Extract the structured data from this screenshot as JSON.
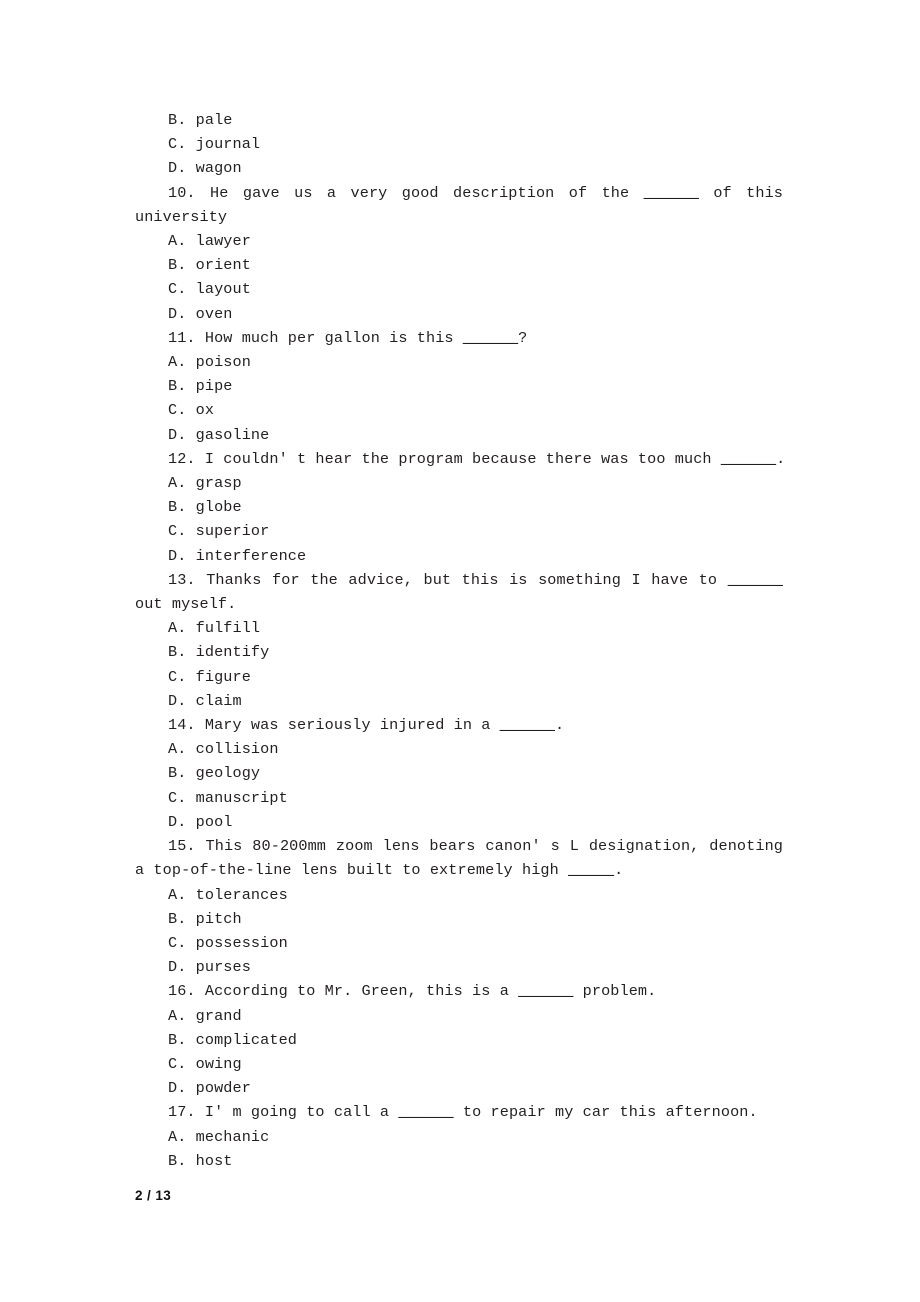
{
  "document": {
    "page_label": "2 / 13"
  },
  "blank_short": "______",
  "blank_tiny": "_____",
  "lines": [
    {
      "kind": "option",
      "text": "B.  pale"
    },
    {
      "kind": "option",
      "text": "C.  journal"
    },
    {
      "kind": "option",
      "text": "D.  wagon"
    },
    {
      "kind": "question_wrap",
      "pre": "10.  He gave us a very good description of the ",
      "blank": "______",
      "post": " of this university",
      "full": "10.  He gave us a very good description of the ______ of this university"
    },
    {
      "kind": "option",
      "text": "A.  lawyer"
    },
    {
      "kind": "option",
      "text": "B.  orient"
    },
    {
      "kind": "option",
      "text": "C.  layout"
    },
    {
      "kind": "option",
      "text": "D.  oven"
    },
    {
      "kind": "question",
      "pre": "11.  How much per gallon is this ",
      "blank": "______",
      "post": "?",
      "full": "11.  How much per gallon is this ______?"
    },
    {
      "kind": "option",
      "text": "A.  poison"
    },
    {
      "kind": "option",
      "text": "B.  pipe"
    },
    {
      "kind": "option",
      "text": "C.  ox"
    },
    {
      "kind": "option",
      "text": "D.  gasoline"
    },
    {
      "kind": "question",
      "pre": "12.  I couldn' t hear the program because there was too much ",
      "blank": "______",
      "post": ".",
      "full": "12.  I couldn' t hear the program because there was too much ______."
    },
    {
      "kind": "option",
      "text": "A.  grasp"
    },
    {
      "kind": "option",
      "text": "B.  globe"
    },
    {
      "kind": "option",
      "text": "C.  superior"
    },
    {
      "kind": "option",
      "text": "D.  interference"
    },
    {
      "kind": "question_wrap",
      "pre": "13.  Thanks for the advice, but this is something I have to ",
      "blank": "______",
      "post": " out myself.",
      "full": "13.  Thanks for the advice, but this is something I have to ______ out myself."
    },
    {
      "kind": "option",
      "text": "A.  fulfill"
    },
    {
      "kind": "option",
      "text": "B.  identify"
    },
    {
      "kind": "option",
      "text": "C.  figure"
    },
    {
      "kind": "option",
      "text": "D.  claim"
    },
    {
      "kind": "question",
      "pre": "14.  Mary was seriously injured in a ",
      "blank": "______",
      "post": ".",
      "full": "14.  Mary was seriously injured in a ______."
    },
    {
      "kind": "option",
      "text": "A.  collision"
    },
    {
      "kind": "option",
      "text": "B.  geology"
    },
    {
      "kind": "option",
      "text": "C.  manuscript"
    },
    {
      "kind": "option",
      "text": "D.  pool"
    },
    {
      "kind": "question_wrap",
      "pre": "15.  This 80-200mm zoom lens bears canon' s L designation, denoting a top-of-the-line lens built to extremely high ",
      "blank": "_____",
      "post": ".",
      "full": "15.  This 80-200mm zoom lens bears canon' s L designation, denoting a top-of-the-line lens built to extremely high _____."
    },
    {
      "kind": "option",
      "text": "A.  tolerances"
    },
    {
      "kind": "option",
      "text": "B.  pitch"
    },
    {
      "kind": "option",
      "text": "C.  possession"
    },
    {
      "kind": "option",
      "text": "D.  purses"
    },
    {
      "kind": "question",
      "pre": "16.  According to Mr. Green, this is a ",
      "blank": "______",
      "post": " problem.",
      "full": "16.  According to Mr. Green, this is a ______ problem."
    },
    {
      "kind": "option",
      "text": "A.  grand"
    },
    {
      "kind": "option",
      "text": "B.  complicated"
    },
    {
      "kind": "option",
      "text": "C.  owing"
    },
    {
      "kind": "option",
      "text": "D.  powder"
    },
    {
      "kind": "question",
      "pre": "17.  I' m going to call a ",
      "blank": "______",
      "post": " to repair my car this afternoon.",
      "full": "17.  I' m going to call a ______ to repair my car this afternoon."
    },
    {
      "kind": "option",
      "text": "A.  mechanic"
    },
    {
      "kind": "option",
      "text": "B.  host"
    }
  ]
}
